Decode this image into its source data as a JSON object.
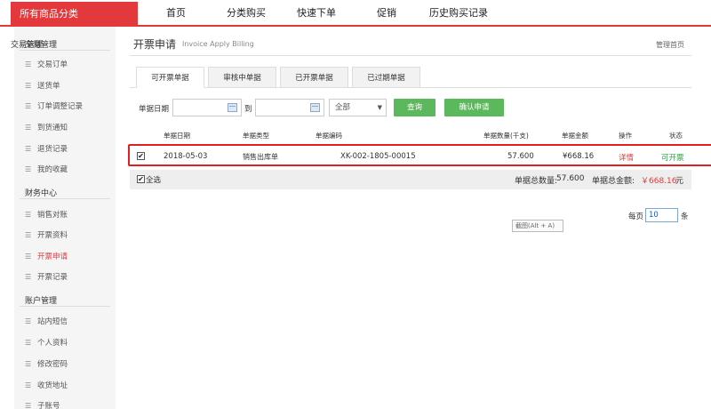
{
  "topnav": {
    "category_label": "所有商品分类",
    "items": [
      "首页",
      "分类购买",
      "快速下单",
      "促销",
      "历史购买记录"
    ]
  },
  "sidebar": {
    "groups": [
      {
        "title": "交易管理",
        "items": [
          "交易订单",
          "送货单",
          "订单调整记录",
          "到货通知",
          "退货记录",
          "我的收藏"
        ]
      },
      {
        "title": "财务中心",
        "items": [
          "销售对账",
          "开票资料",
          "开票申请",
          "开票记录"
        ]
      },
      {
        "title": "账户管理",
        "items": [
          "站内短信",
          "个人资料",
          "修改密码",
          "收货地址",
          "子账号"
        ]
      }
    ],
    "active_item": "开票申请"
  },
  "page": {
    "title": "开票申请",
    "subtitle": "Invoice Apply Billing",
    "manage_link": "管理首页"
  },
  "tabs": [
    "可开票单据",
    "审核中单据",
    "已开票单据",
    "已过期单据"
  ],
  "active_tab": 0,
  "filter": {
    "date_label": "单据日期",
    "to_label": "到",
    "start_date": "",
    "end_date": "",
    "select_value": "全部",
    "query_button": "查询",
    "confirm_button": "确认申请"
  },
  "table": {
    "headers": [
      "单据日期",
      "单据类型",
      "单据编码",
      "单据数量(千支)",
      "单据金额",
      "操作",
      "状态"
    ],
    "rows": [
      {
        "checked": true,
        "date": "2018-05-03",
        "type": "销售出库单",
        "code": "XK-002-1805-00015",
        "qty": "57.600",
        "amount": "¥668.16",
        "action": "详情",
        "status": "可开票"
      }
    ]
  },
  "summary": {
    "select_all": "全选",
    "total_qty_label": "单据总数量:",
    "total_qty": "57.600",
    "total_amount_label": "单据总金额:",
    "total_amount": "￥668.16",
    "currency_suffix": "元"
  },
  "pagination": {
    "per_page_label": "每页",
    "per_page_value": "10",
    "unit": "条"
  },
  "tooltip": "截图(Alt + A)",
  "colors": {
    "brand_red": "#e4393c",
    "button_green": "#5cb85c",
    "status_green": "#2ea043",
    "highlight_box": "#e02020"
  }
}
